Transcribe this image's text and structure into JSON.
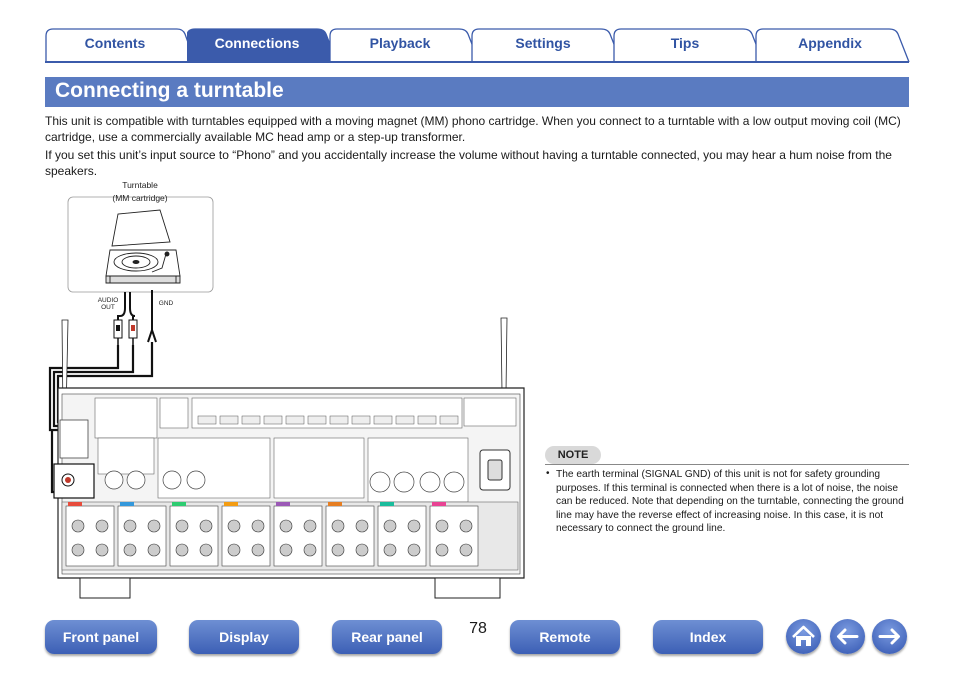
{
  "tabs": [
    {
      "label": "Contents"
    },
    {
      "label": "Connections",
      "active": true
    },
    {
      "label": "Playback"
    },
    {
      "label": "Settings"
    },
    {
      "label": "Tips"
    },
    {
      "label": "Appendix"
    }
  ],
  "page": {
    "title": "Connecting a turntable",
    "para1": "This unit is compatible with turntables equipped with a moving magnet (MM) phono cartridge. When you connect to a turntable with a low output moving coil (MC) cartridge, use a commercially available MC head amp or a step-up transformer.",
    "para2": "If you set this unit’s input source to “Phono” and you accidentally increase the volume without having a turntable connected, you may hear a hum noise from the speakers."
  },
  "diagram": {
    "turntable_label_1": "Turntable",
    "turntable_label_2": "(MM cartridge)",
    "audio_out_1": "AUDIO",
    "audio_out_2": "OUT",
    "gnd": "GND"
  },
  "note": {
    "label": "NOTE",
    "text": "The earth terminal (SIGNAL GND) of this unit is not for safety grounding purposes. If this terminal is connected when there is a lot of noise, the noise can be reduced. Note that depending on the turntable, connecting the ground line may have the reverse effect of increasing noise. In this case, it is not necessary to connect the ground line."
  },
  "nav": {
    "front_panel": "Front panel",
    "display": "Display",
    "rear_panel": "Rear panel",
    "page_number": "78",
    "remote": "Remote",
    "index": "Index"
  },
  "icons": {
    "home": "home-icon",
    "back": "arrow-left-icon",
    "forward": "arrow-right-icon"
  },
  "colors": {
    "accent": "#3b5bab",
    "title_band": "#5a7bc1",
    "button": "#4a6cc0"
  }
}
